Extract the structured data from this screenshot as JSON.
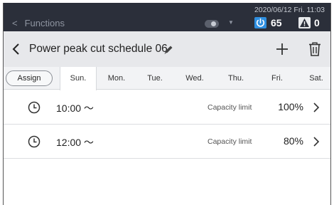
{
  "topbar": {
    "back_label": "Functions",
    "dropdown_arrow": "▼",
    "datetime": "2020/06/12 Fri. 11:03",
    "power_value": "65",
    "warning_value": "0",
    "power_icon_color": "#2f8fe0",
    "icons": [
      "chevron-left-icon",
      "toggle-icon",
      "power-icon",
      "warning-icon"
    ]
  },
  "header": {
    "title": "Power peak cut schedule 06",
    "icons": [
      "back-arrow-icon",
      "pencil-icon",
      "plus-icon",
      "trash-icon"
    ]
  },
  "tabs": {
    "assign_label": "Assign",
    "days": [
      "Sun.",
      "Mon.",
      "Tue.",
      "Wed.",
      "Thu.",
      "Fri.",
      "Sat."
    ],
    "active_index": 0
  },
  "schedule": [
    {
      "time": "10:00 ～",
      "capacity_label": "Capacity limit",
      "capacity_value": "100%"
    },
    {
      "time": "12:00 ～",
      "capacity_label": "Capacity limit",
      "capacity_value": "80%"
    }
  ]
}
